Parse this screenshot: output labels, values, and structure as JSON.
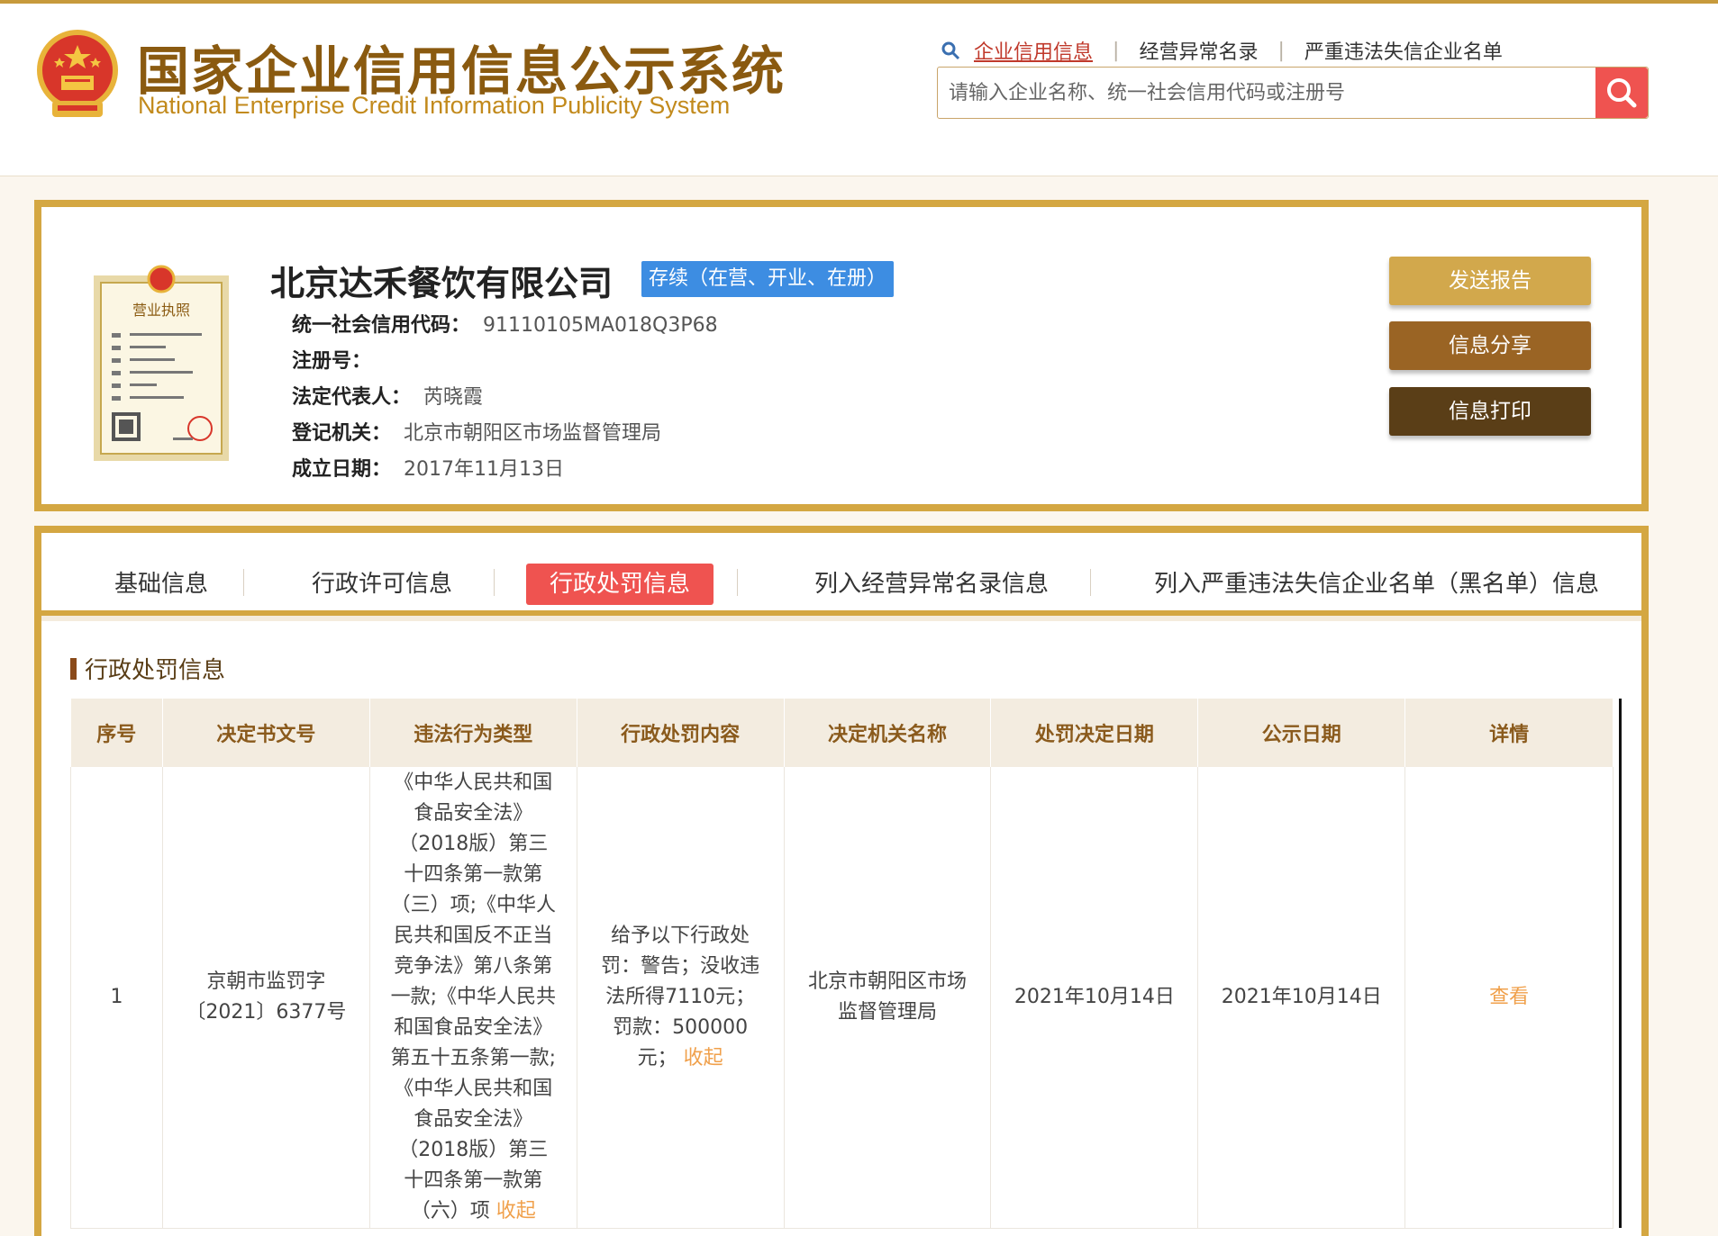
{
  "site": {
    "title_cn": "国家企业信用信息公示系统",
    "title_en": "National Enterprise Credit Information Publicity System"
  },
  "topnav": {
    "items": [
      {
        "label": "企业信用信息",
        "active": true
      },
      {
        "label": "经营异常名录",
        "active": false
      },
      {
        "label": "严重违法失信企业名单",
        "active": false
      }
    ],
    "separator": "|"
  },
  "search": {
    "placeholder": "请输入企业名称、统一社会信用代码或注册号",
    "value": ""
  },
  "company": {
    "name": "北京达禾餐饮有限公司",
    "status": "存续（在营、开业、在册）",
    "fields": [
      {
        "label": "统一社会信用代码：",
        "value": "91110105MA018Q3P68"
      },
      {
        "label": "注册号：",
        "value": ""
      },
      {
        "label": "法定代表人：",
        "value": "芮晓霞"
      },
      {
        "label": "登记机关：",
        "value": "北京市朝阳区市场监督管理局"
      },
      {
        "label": "成立日期：",
        "value": "2017年11月13日"
      }
    ],
    "license_image_text": "营业执照"
  },
  "actions": {
    "send": "发送报告",
    "share": "信息分享",
    "print": "信息打印"
  },
  "tabs": [
    {
      "label": "基础信息",
      "active": false
    },
    {
      "label": "行政许可信息",
      "active": false
    },
    {
      "label": "行政处罚信息",
      "active": true
    },
    {
      "label": "列入经营异常名录信息",
      "active": false
    },
    {
      "label": "列入严重违法失信企业名单（黑名单）信息",
      "active": false
    }
  ],
  "section": {
    "title": "行政处罚信息"
  },
  "table": {
    "headers": [
      "序号",
      "决定书文号",
      "违法行为类型",
      "行政处罚内容",
      "决定机关名称",
      "处罚决定日期",
      "公示日期",
      "详情"
    ],
    "rows": [
      {
        "index": "1",
        "doc_no": "京朝市监罚字〔2021〕6377号",
        "violation": "《中华人民共和国食品安全法》（2018版）第三十四条第一款第（三）项;《中华人民共和国反不正当竞争法》第八条第一款;《中华人民共和国食品安全法》第五十五条第一款;《中华人民共和国食品安全法》（2018版）第三十四条第一款第（六）项",
        "violation_toggle": "收起",
        "content": "给予以下行政处罚：警告；没收违法所得7110元；罚款：500000元；",
        "content_toggle": "收起",
        "authority": "北京市朝阳区市场监督管理局",
        "decision_date": "2021年10月14日",
        "publish_date": "2021年10月14日",
        "detail": "查看"
      }
    ]
  },
  "colors": {
    "gold_border": "#d4a742",
    "accent_red": "#ef5350",
    "status_blue": "#3d8de2",
    "link_orange": "#f0a04b"
  }
}
